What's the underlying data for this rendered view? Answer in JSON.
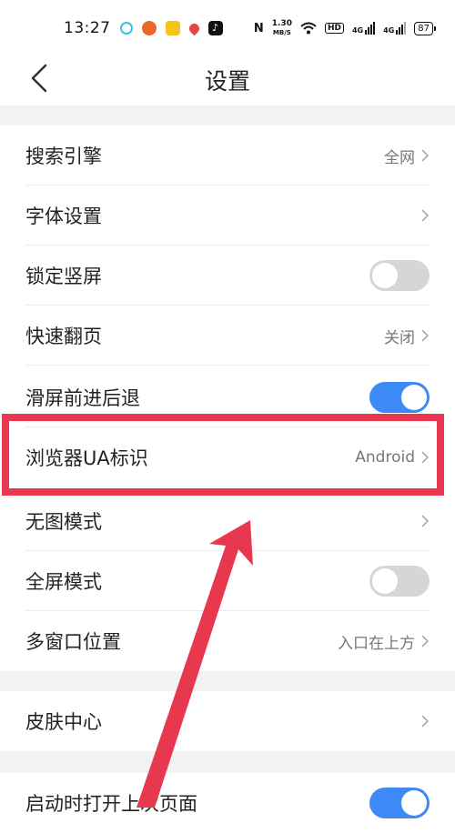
{
  "status_bar": {
    "time": "13:27",
    "net_speed_value": "1.30",
    "net_speed_unit": "MB/S",
    "hd_label": "HD",
    "net_4g_1": "4G",
    "net_4g_2": "4G",
    "battery": "87"
  },
  "header": {
    "title": "设置"
  },
  "settings": [
    {
      "label": "搜索引擎",
      "value": "全网",
      "control": "chevron"
    },
    {
      "label": "字体设置",
      "value": "",
      "control": "chevron"
    },
    {
      "label": "锁定竖屏",
      "control": "toggle",
      "state": "off"
    },
    {
      "label": "快速翻页",
      "value": "关闭",
      "control": "chevron"
    },
    {
      "label": "滑屏前进后退",
      "control": "toggle",
      "state": "on"
    },
    {
      "label": "浏览器UA标识",
      "value": "Android",
      "control": "chevron"
    },
    {
      "label": "无图模式",
      "value": "",
      "control": "chevron"
    },
    {
      "label": "全屏模式",
      "control": "toggle",
      "state": "off"
    },
    {
      "label": "多窗口位置",
      "value": "入口在上方",
      "control": "chevron"
    },
    {
      "label": "皮肤中心",
      "value": "",
      "control": "chevron"
    },
    {
      "label": "启动时打开上次页面",
      "control": "toggle",
      "state": "on"
    }
  ],
  "colors": {
    "accent": "#3d8af7",
    "annotation": "#e8384f"
  }
}
